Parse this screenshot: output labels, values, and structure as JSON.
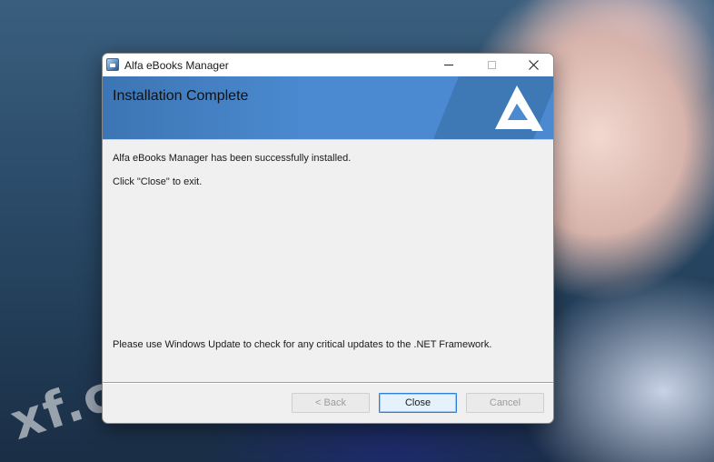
{
  "window": {
    "title": "Alfa eBooks Manager",
    "app_icon": "installer-app-icon"
  },
  "title_bar": {
    "minimize_icon": "minimize-icon",
    "maximize_icon": "maximize-icon",
    "close_icon": "close-icon"
  },
  "banner": {
    "title": "Installation Complete",
    "logo_icon": "alfa-triangle-logo-icon",
    "colors": {
      "banner_blue": "#4b8ad0",
      "banner_dark": "#3c75b3",
      "logo": "#ffffff"
    }
  },
  "messages": {
    "installed": "Alfa eBooks Manager has been successfully installed.",
    "exit_hint": "Click \"Close\" to exit.",
    "update_note": "Please use Windows Update to check for any critical updates to the .NET Framework."
  },
  "buttons": {
    "back": "< Back",
    "close": "Close",
    "cancel": "Cancel"
  },
  "desktop": {
    "watermark": "xf.c"
  }
}
